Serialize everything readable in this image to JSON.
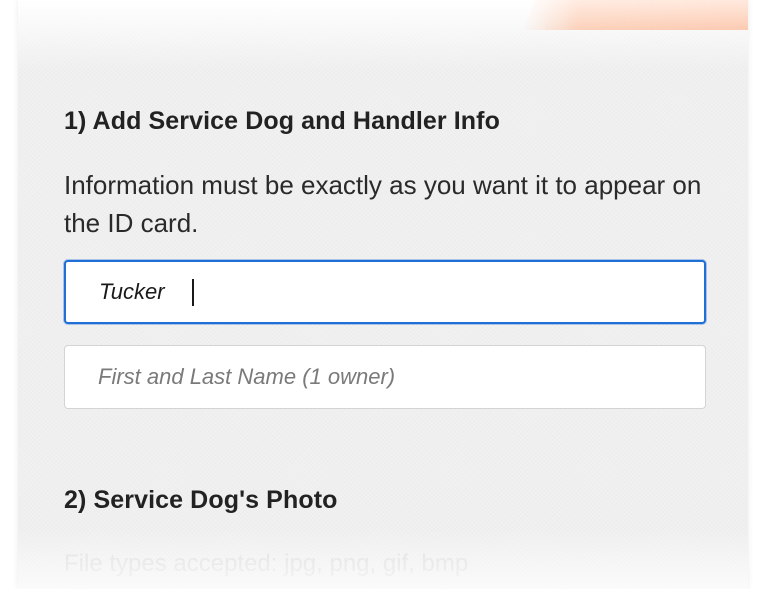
{
  "section1": {
    "title": "1) Add Service Dog and Handler Info",
    "description": "Information must be exactly as you want it to appear on the ID card.",
    "dog_name_field": {
      "value": "Tucker",
      "placeholder": ""
    },
    "owner_name_field": {
      "value": "",
      "placeholder": "First and Last Name (1 owner)"
    }
  },
  "section2": {
    "title": "2) Service Dog's Photo",
    "file_types": "File types accepted: jpg, png, gif, bmp"
  },
  "colors": {
    "focus_border": "#1f6fd6",
    "accent_tab": "#ffa06e",
    "panel_bg": "#f1f1f1"
  }
}
